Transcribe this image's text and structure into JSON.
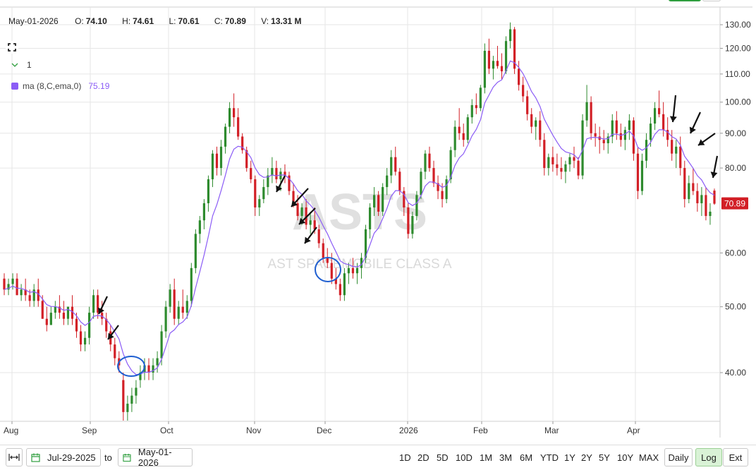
{
  "header": {
    "date": "May-01-2026",
    "open_label": "O:",
    "open": "74.10",
    "high_label": "H:",
    "high": "74.61",
    "low_label": "L:",
    "low": "70.61",
    "close_label": "C:",
    "close": "70.89",
    "volume_label": "V:",
    "volume": "13.31 M"
  },
  "legend": {
    "collapse_count": "1",
    "ma_label": "ma (8,C,ema,0)",
    "ma_value": "75.19",
    "ma_color": "#8b5cf6"
  },
  "watermark": {
    "symbol": "ASTS",
    "name": "AST SpaceMobile Class A"
  },
  "colors": {
    "up": "#2e8b2e",
    "down": "#d21f26",
    "price_tag": "#d21f26",
    "grid": "#e6e6e6"
  },
  "toolbar": {
    "from_date": "Jul-29-2025",
    "to_label": "to",
    "to_date": "May-01-2026",
    "ranges": [
      "1D",
      "2D",
      "5D",
      "10D",
      "1M",
      "3M",
      "6M",
      "YTD",
      "1Y",
      "2Y",
      "5Y",
      "10Y",
      "MAX"
    ],
    "daily_label": "Daily",
    "log_label": "Log",
    "ext_label": "Ext"
  },
  "chart_data": {
    "type": "candlestick",
    "scale": "log",
    "ylim": [
      33,
      135
    ],
    "y_ticks": [
      "130.00",
      "120.00",
      "110.00",
      "100.00",
      "90.00",
      "80.00",
      "60.00",
      "50.00",
      "40.00"
    ],
    "x_ticks": [
      "Aug",
      "Sep",
      "Oct",
      "Nov",
      "Dec",
      "2026",
      "Feb",
      "Mar",
      "Apr"
    ],
    "last_price_label": "70.89",
    "series": [
      {
        "name": "ASTS",
        "type": "candlestick"
      },
      {
        "name": "ma (8,C,ema,0)",
        "type": "line",
        "values": "ema of close"
      }
    ],
    "candles": [
      [
        55,
        56,
        52,
        53
      ],
      [
        53,
        55,
        52,
        54
      ],
      [
        54,
        56,
        53,
        55
      ],
      [
        55,
        56,
        52,
        52
      ],
      [
        52,
        54,
        51,
        53
      ],
      [
        53,
        55,
        51,
        52
      ],
      [
        52,
        53,
        50,
        51
      ],
      [
        51,
        54,
        50,
        53
      ],
      [
        53,
        55,
        50,
        51
      ],
      [
        51,
        52,
        48,
        48
      ],
      [
        48,
        50,
        46,
        47
      ],
      [
        47,
        50,
        47,
        49
      ],
      [
        49,
        51,
        48,
        50
      ],
      [
        50,
        52,
        48,
        49
      ],
      [
        49,
        51,
        47,
        48
      ],
      [
        48,
        50,
        47,
        50
      ],
      [
        50,
        52,
        47,
        48
      ],
      [
        48,
        49,
        45,
        46
      ],
      [
        46,
        47,
        43,
        44
      ],
      [
        44,
        46,
        43,
        45
      ],
      [
        45,
        50,
        44,
        49
      ],
      [
        49,
        53,
        48,
        52
      ],
      [
        52,
        53,
        48,
        49
      ],
      [
        49,
        51,
        47,
        48
      ],
      [
        48,
        49,
        45,
        46
      ],
      [
        46,
        47,
        43,
        44
      ],
      [
        44,
        45,
        41,
        42
      ],
      [
        42,
        43,
        40,
        41
      ],
      [
        39,
        40,
        34,
        35
      ],
      [
        35,
        37,
        34,
        36
      ],
      [
        36,
        38,
        35,
        37
      ],
      [
        37,
        39,
        36,
        38
      ],
      [
        39,
        41,
        38,
        40
      ],
      [
        40,
        42,
        39,
        41
      ],
      [
        41,
        42,
        39,
        40
      ],
      [
        40,
        42,
        39,
        41
      ],
      [
        41,
        43,
        40,
        42
      ],
      [
        42,
        47,
        41,
        46
      ],
      [
        46,
        51,
        45,
        50
      ],
      [
        50,
        54,
        49,
        53
      ],
      [
        53,
        55,
        47,
        48
      ],
      [
        48,
        51,
        47,
        50
      ],
      [
        50,
        53,
        48,
        49
      ],
      [
        49,
        52,
        48,
        51
      ],
      [
        51,
        58,
        50,
        57
      ],
      [
        57,
        65,
        56,
        64
      ],
      [
        64,
        68,
        62,
        67
      ],
      [
        67,
        72,
        65,
        71
      ],
      [
        71,
        78,
        69,
        77
      ],
      [
        77,
        85,
        75,
        84
      ],
      [
        84,
        86,
        78,
        80
      ],
      [
        80,
        88,
        78,
        86
      ],
      [
        86,
        93,
        84,
        92
      ],
      [
        92,
        100,
        90,
        98
      ],
      [
        98,
        103,
        92,
        95
      ],
      [
        95,
        98,
        88,
        89
      ],
      [
        89,
        90,
        84,
        85
      ],
      [
        85,
        86,
        79,
        80
      ],
      [
        80,
        82,
        76,
        77
      ],
      [
        77,
        78,
        68,
        70
      ],
      [
        70,
        73,
        68,
        72
      ],
      [
        72,
        77,
        71,
        75
      ],
      [
        75,
        80,
        73,
        78
      ],
      [
        78,
        83,
        76,
        80
      ],
      [
        80,
        82,
        76,
        77
      ],
      [
        77,
        80,
        74,
        79
      ],
      [
        79,
        81,
        76,
        78
      ],
      [
        78,
        79,
        73,
        74
      ],
      [
        74,
        76,
        70,
        71
      ],
      [
        71,
        73,
        67,
        68
      ],
      [
        68,
        71,
        66,
        70
      ],
      [
        70,
        72,
        65,
        66
      ],
      [
        66,
        69,
        64,
        67
      ],
      [
        67,
        70,
        64,
        65
      ],
      [
        65,
        66,
        61,
        62
      ],
      [
        62,
        63,
        58,
        59
      ],
      [
        59,
        61,
        57,
        58
      ],
      [
        58,
        60,
        54,
        55
      ],
      [
        55,
        57,
        53,
        54
      ],
      [
        54,
        55,
        51,
        52
      ],
      [
        52,
        57,
        51,
        56
      ],
      [
        56,
        58,
        54,
        57
      ],
      [
        57,
        59,
        55,
        56
      ],
      [
        56,
        58,
        54,
        57
      ],
      [
        57,
        60,
        55,
        59
      ],
      [
        59,
        66,
        58,
        65
      ],
      [
        65,
        71,
        63,
        70
      ],
      [
        70,
        75,
        68,
        73
      ],
      [
        73,
        74,
        68,
        69
      ],
      [
        69,
        76,
        68,
        75
      ],
      [
        75,
        80,
        73,
        78
      ],
      [
        78,
        85,
        76,
        83
      ],
      [
        83,
        86,
        78,
        79
      ],
      [
        79,
        80,
        73,
        74
      ],
      [
        74,
        75,
        68,
        70
      ],
      [
        70,
        71,
        63,
        64
      ],
      [
        64,
        69,
        63,
        68
      ],
      [
        68,
        74,
        67,
        73
      ],
      [
        73,
        80,
        72,
        79
      ],
      [
        79,
        85,
        77,
        84
      ],
      [
        84,
        86,
        79,
        80
      ],
      [
        80,
        82,
        75,
        76
      ],
      [
        76,
        78,
        72,
        74
      ],
      [
        74,
        76,
        70,
        72
      ],
      [
        72,
        78,
        71,
        77
      ],
      [
        77,
        86,
        76,
        85
      ],
      [
        85,
        94,
        83,
        92
      ],
      [
        92,
        98,
        88,
        90
      ],
      [
        90,
        93,
        86,
        88
      ],
      [
        88,
        96,
        87,
        95
      ],
      [
        95,
        101,
        93,
        99
      ],
      [
        99,
        103,
        96,
        98
      ],
      [
        98,
        106,
        97,
        105
      ],
      [
        105,
        122,
        103,
        119
      ],
      [
        119,
        124,
        110,
        112
      ],
      [
        112,
        117,
        108,
        115
      ],
      [
        115,
        121,
        112,
        113
      ],
      [
        113,
        118,
        108,
        111
      ],
      [
        111,
        125,
        110,
        123
      ],
      [
        123,
        131,
        120,
        128
      ],
      [
        128,
        129,
        110,
        112
      ],
      [
        112,
        115,
        104,
        106
      ],
      [
        106,
        109,
        100,
        102
      ],
      [
        102,
        104,
        94,
        96
      ],
      [
        96,
        98,
        90,
        92
      ],
      [
        92,
        95,
        88,
        94
      ],
      [
        94,
        97,
        86,
        88
      ],
      [
        88,
        90,
        78,
        80
      ],
      [
        80,
        84,
        78,
        83
      ],
      [
        83,
        86,
        79,
        81
      ],
      [
        81,
        84,
        78,
        80
      ],
      [
        80,
        83,
        77,
        79
      ],
      [
        79,
        82,
        76,
        81
      ],
      [
        81,
        84,
        79,
        83
      ],
      [
        83,
        86,
        80,
        82
      ],
      [
        82,
        83,
        77,
        78
      ],
      [
        78,
        96,
        77,
        94
      ],
      [
        94,
        106,
        92,
        100
      ],
      [
        100,
        102,
        88,
        90
      ],
      [
        90,
        93,
        86,
        89
      ],
      [
        89,
        92,
        84,
        88
      ],
      [
        88,
        91,
        85,
        87
      ],
      [
        87,
        90,
        84,
        89
      ],
      [
        89,
        96,
        87,
        94
      ],
      [
        94,
        97,
        88,
        90
      ],
      [
        90,
        93,
        86,
        88
      ],
      [
        88,
        92,
        85,
        91
      ],
      [
        91,
        96,
        88,
        94
      ],
      [
        94,
        95,
        82,
        84
      ],
      [
        84,
        86,
        72,
        74
      ],
      [
        74,
        84,
        73,
        82
      ],
      [
        82,
        90,
        80,
        88
      ],
      [
        88,
        95,
        86,
        93
      ],
      [
        93,
        100,
        91,
        98
      ],
      [
        98,
        104,
        95,
        96
      ],
      [
        96,
        100,
        89,
        91
      ],
      [
        91,
        95,
        86,
        88
      ],
      [
        88,
        91,
        82,
        84
      ],
      [
        84,
        88,
        80,
        86
      ],
      [
        86,
        89,
        78,
        80
      ],
      [
        80,
        82,
        70,
        72
      ],
      [
        72,
        78,
        71,
        76
      ],
      [
        76,
        80,
        73,
        74
      ],
      [
        74,
        76,
        69,
        71
      ],
      [
        71,
        75,
        68,
        73
      ],
      [
        73,
        75,
        67,
        68
      ],
      [
        68,
        71,
        66,
        69
      ],
      [
        74.1,
        74.61,
        70.61,
        70.89
      ]
    ],
    "ma_last": 75.19
  }
}
